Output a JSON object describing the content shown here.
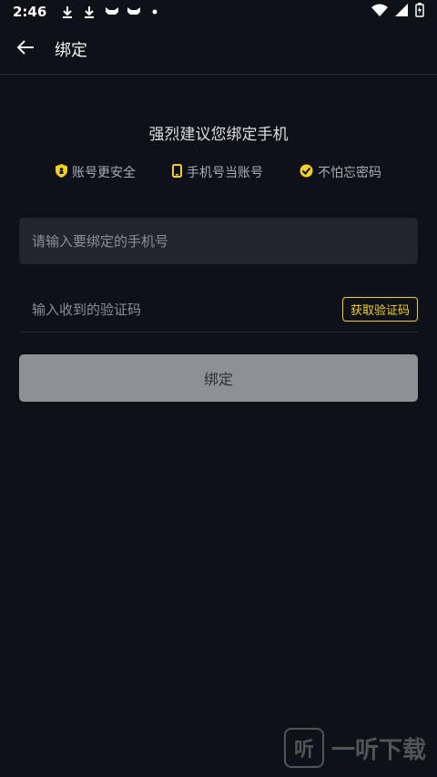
{
  "status_bar": {
    "time": "2:46"
  },
  "header": {
    "title": "绑定"
  },
  "headline": "强烈建议您绑定手机",
  "benefits": [
    {
      "label": "账号更安全",
      "icon": "shield-icon"
    },
    {
      "label": "手机号当账号",
      "icon": "phone-icon"
    },
    {
      "label": "不怕忘密码",
      "icon": "check-badge-icon"
    }
  ],
  "form": {
    "phone_placeholder": "请输入要绑定的手机号",
    "code_placeholder": "输入收到的验证码",
    "get_code_label": "获取验证码",
    "submit_label": "绑定"
  },
  "watermark": {
    "text": "一听下载",
    "badge": "听"
  },
  "colors": {
    "accent": "#f2d125",
    "background": "#0f1118",
    "button_disabled": "#8e9096"
  }
}
